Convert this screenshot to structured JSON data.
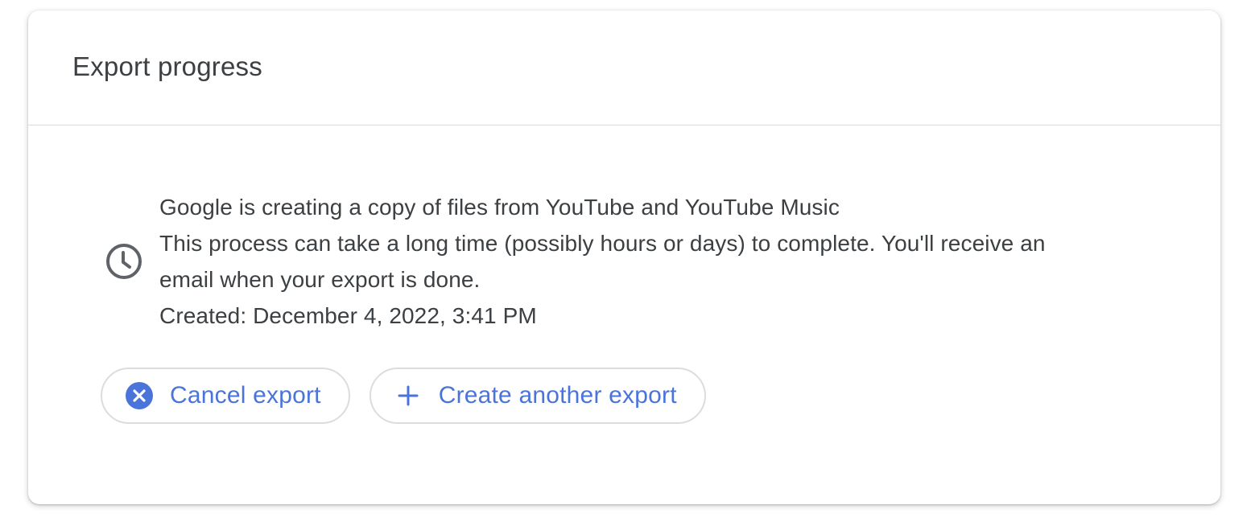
{
  "card": {
    "title": "Export progress"
  },
  "status": {
    "icon": "clock-icon",
    "headline": "Google is creating a copy of files from YouTube and YouTube Music",
    "description_line1": "This process can take a long time (possibly hours or days) to complete. You'll receive an",
    "description_line2": "email when your export is done.",
    "created": "Created: December 4, 2022, 3:41 PM"
  },
  "actions": {
    "cancel_label": "Cancel export",
    "cancel_icon": "cancel-circle-icon",
    "create_label": "Create another export",
    "create_icon": "plus-icon"
  },
  "colors": {
    "accent": "#4a74d9",
    "text": "#3c4043",
    "icon_gray": "#5f6368",
    "border": "#dadce0"
  }
}
